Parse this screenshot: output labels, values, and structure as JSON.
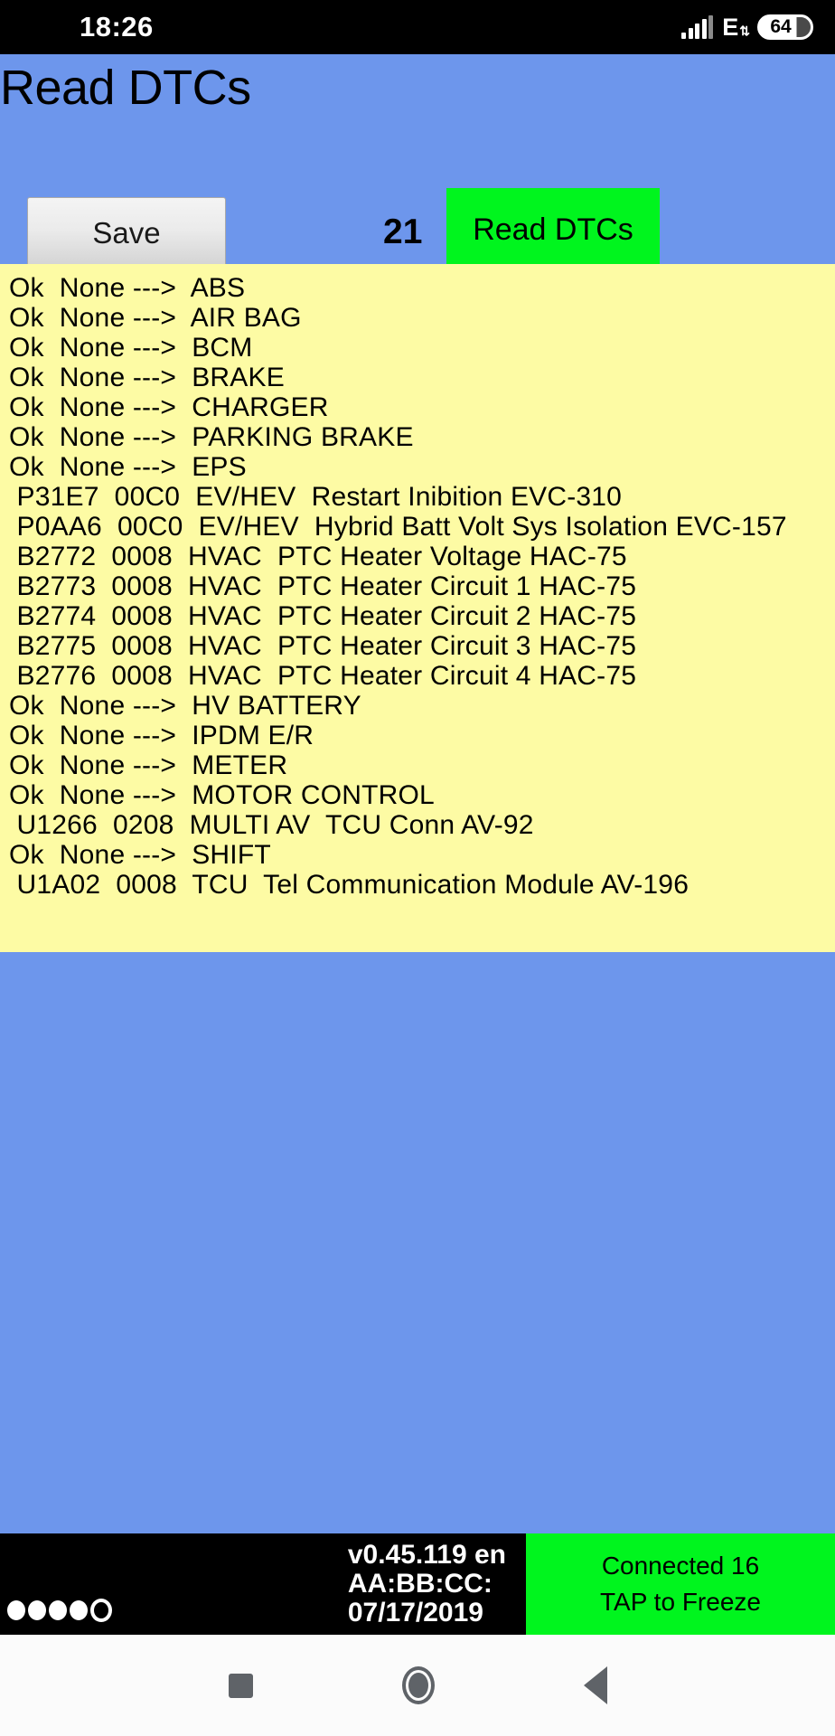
{
  "status_bar": {
    "clock": "18:26",
    "network_type": "E",
    "battery_level": "64",
    "signal_icon": "signal-bars-icon",
    "data_arrows_icon": "data-transfer-arrows-icon"
  },
  "app": {
    "title": "Read DTCs",
    "save_label": "Save",
    "dtc_count": "21",
    "read_label": "Read DTCs",
    "colors": {
      "background": "#6d96ec",
      "results_background": "#fdfba4",
      "accent_green": "#00f51e",
      "save_button": "#ebebeb"
    }
  },
  "results": {
    "rows": [
      "Ok  None --->  ABS",
      "Ok  None --->  AIR BAG",
      "Ok  None --->  BCM",
      "Ok  None --->  BRAKE",
      "Ok  None --->  CHARGER",
      "Ok  None --->  PARKING BRAKE",
      "Ok  None --->  EPS",
      " P31E7  00C0  EV/HEV  Restart Inibition EVC-310",
      " P0AA6  00C0  EV/HEV  Hybrid Batt Volt Sys Isolation EVC-157",
      " B2772  0008  HVAC  PTC Heater Voltage HAC-75",
      " B2773  0008  HVAC  PTC Heater Circuit 1 HAC-75",
      " B2774  0008  HVAC  PTC Heater Circuit 2 HAC-75",
      " B2775  0008  HVAC  PTC Heater Circuit 3 HAC-75",
      " B2776  0008  HVAC  PTC Heater Circuit 4 HAC-75",
      "Ok  None --->  HV BATTERY",
      "Ok  None --->  IPDM E/R",
      "Ok  None --->  METER",
      "Ok  None --->  MOTOR CONTROL",
      " U1266  0208  MULTI AV  TCU Conn AV-92",
      "Ok  None --->  SHIFT",
      " U1A02  0008  TCU  Tel Communication Module AV-196"
    ]
  },
  "bottom_bar": {
    "progress_dots": "4 filled 1 hollow",
    "version": "v0.45.119 en",
    "device_id": "AA:BB:CC:",
    "date": "07/17/2019",
    "connection_status": "Connected 16",
    "connection_action": "TAP to Freeze"
  },
  "nav_bar": {
    "recents": "recents-square-icon",
    "home": "home-circle-icon",
    "back": "back-triangle-icon"
  }
}
